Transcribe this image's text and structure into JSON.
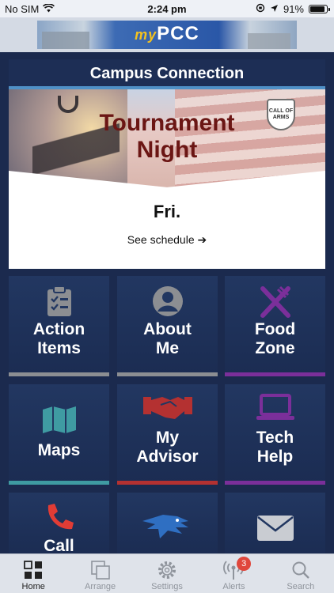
{
  "status_bar": {
    "carrier": "No SIM",
    "time": "2:24 pm",
    "battery": "91%",
    "battery_level": 0.91
  },
  "header": {
    "brand_my": "my",
    "brand_name": "PCC"
  },
  "campus_connection": {
    "title": "Campus Connection",
    "event": {
      "headline_line1": "Tournament",
      "headline_line2": "Night",
      "badge_text": "CALL OF ARMS",
      "date": "Fri.",
      "link_label": "See schedule",
      "link_arrow": "➔"
    }
  },
  "tiles": [
    {
      "label_line1": "Action",
      "label_line2": "Items",
      "icon": "clipboard-checklist-icon",
      "accent": "#8c8e92"
    },
    {
      "label_line1": "About",
      "label_line2": "Me",
      "icon": "user-circle-icon",
      "accent": "#8c8e92"
    },
    {
      "label_line1": "Food",
      "label_line2": "Zone",
      "icon": "fork-knife-icon",
      "accent": "#7b2f9a"
    },
    {
      "label_line1": "Maps",
      "label_line2": "",
      "icon": "map-icon",
      "accent": "#3f9ba2"
    },
    {
      "label_line1": "My",
      "label_line2": "Advisor",
      "icon": "handshake-icon",
      "accent": "#b43131"
    },
    {
      "label_line1": "Tech",
      "label_line2": "Help",
      "icon": "laptop-icon",
      "accent": "#7b2f9a"
    },
    {
      "label_line1": "Call",
      "label_line2": "",
      "icon": "phone-icon",
      "accent": "#e13c35"
    },
    {
      "label_line1": "",
      "label_line2": "",
      "icon": "eagle-mascot-icon",
      "accent": "#2f6fc2"
    },
    {
      "label_line1": "",
      "label_line2": "",
      "icon": "envelope-icon",
      "accent": "#c9ccd2"
    }
  ],
  "tab_bar": {
    "items": [
      {
        "label": "Home",
        "icon": "grid-icon",
        "active": true
      },
      {
        "label": "Arrange",
        "icon": "arrange-icon",
        "active": false
      },
      {
        "label": "Settings",
        "icon": "gear-icon",
        "active": false
      },
      {
        "label": "Alerts",
        "icon": "broadcast-icon",
        "active": false,
        "badge": "3"
      },
      {
        "label": "Search",
        "icon": "search-icon",
        "active": false
      }
    ]
  }
}
